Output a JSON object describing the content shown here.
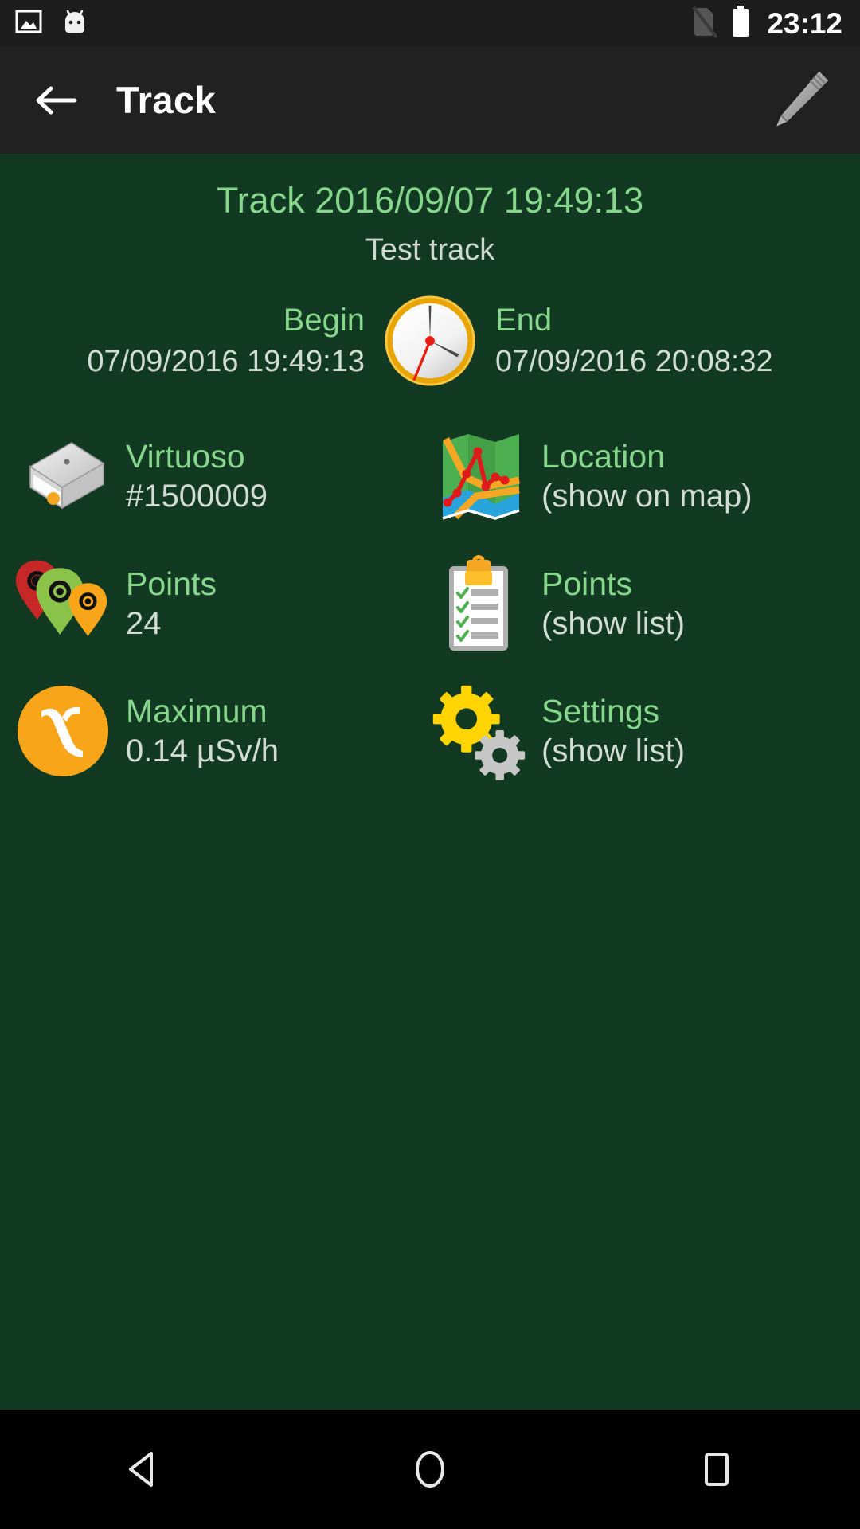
{
  "status_bar": {
    "time": "23:12",
    "icons": [
      "screenshot-icon",
      "android-mascot-icon",
      "no-sim-icon",
      "battery-icon"
    ]
  },
  "toolbar": {
    "back_icon": "arrow-left-icon",
    "title": "Track",
    "edit_icon": "pencil-icon"
  },
  "track": {
    "title": "Track 2016/09/07 19:49:13",
    "subtitle": "Test track"
  },
  "period": {
    "clock_icon": "clock-icon",
    "begin_label": "Begin",
    "begin_value": "07/09/2016 19:49:13",
    "end_label": "End",
    "end_value": "07/09/2016 20:08:32"
  },
  "info": [
    {
      "icon": "device-box-icon",
      "label": "Virtuoso",
      "value": "#1500009"
    },
    {
      "icon": "folded-map-icon",
      "label": "Location",
      "value": "(show on map)"
    },
    {
      "icon": "radiation-pins-icon",
      "label": "Points",
      "value": "24"
    },
    {
      "icon": "clipboard-checklist-icon",
      "label": "Points",
      "value": "(show list)"
    },
    {
      "icon": "gamma-radiation-icon",
      "label": "Maximum",
      "value": "0.14 µSv/h"
    },
    {
      "icon": "gears-icon",
      "label": "Settings",
      "value": "(show list)"
    }
  ],
  "navbar": {
    "back_icon": "nav-back-triangle-icon",
    "home_icon": "nav-home-circle-icon",
    "recents_icon": "nav-recents-square-icon"
  },
  "colors": {
    "background": "#123a23",
    "toolbar": "#212121",
    "status_bar": "#1d1d1d",
    "accent_green": "#86d68c",
    "value_text": "#d2dcd2",
    "navbar": "#000000",
    "orange": "#f9a51a",
    "yellow": "#ffd400"
  }
}
